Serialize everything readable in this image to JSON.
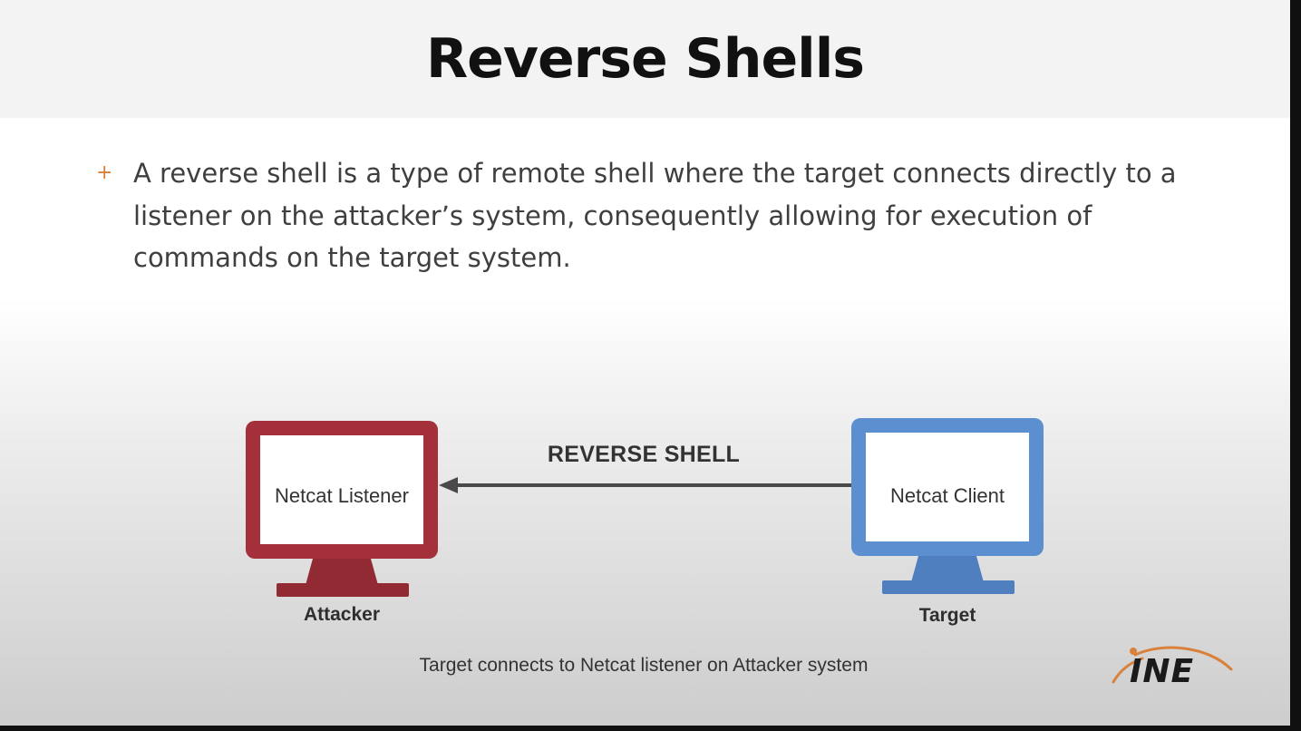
{
  "slide": {
    "title": "Reverse Shells",
    "bullet": "A reverse shell is a type of remote shell where the target connects directly to a listener on the attacker’s system, consequently allowing for execution of commands on the target system."
  },
  "diagram": {
    "attacker": {
      "screen_label": "Netcat Listener",
      "caption": "Attacker",
      "color": "#a3303a"
    },
    "target": {
      "screen_label": "Netcat Client",
      "caption": "Target",
      "color": "#5b8fd0"
    },
    "arrow_label": "REVERSE SHELL",
    "caption": "Target connects to Netcat listener on Attacker system"
  },
  "logo": {
    "text": "INE",
    "accent": "#d9813a"
  },
  "colors": {
    "bullet_accent": "#d9813a",
    "title_bar": "#f3f3f3"
  }
}
